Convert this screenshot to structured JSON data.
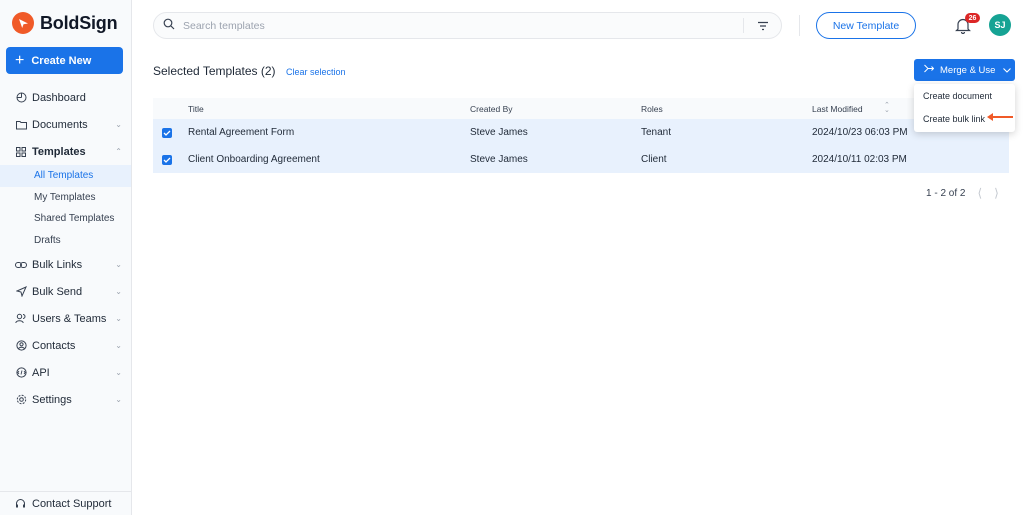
{
  "app": {
    "name": "BoldSign"
  },
  "sidebar": {
    "create_label": "Create New",
    "items": [
      {
        "label": "Dashboard",
        "icon": "dashboard-icon"
      },
      {
        "label": "Documents",
        "icon": "folder-icon"
      },
      {
        "label": "Templates",
        "icon": "grid-icon"
      },
      {
        "label": "Bulk Links",
        "icon": "link-icon"
      },
      {
        "label": "Bulk Send",
        "icon": "send-icon"
      },
      {
        "label": "Users & Teams",
        "icon": "users-icon"
      },
      {
        "label": "Contacts",
        "icon": "contact-icon"
      },
      {
        "label": "API",
        "icon": "api-icon"
      },
      {
        "label": "Settings",
        "icon": "gear-icon"
      }
    ],
    "template_sub": [
      "All Templates",
      "My Templates",
      "Shared Templates",
      "Drafts"
    ],
    "contact_support": "Contact Support"
  },
  "header": {
    "search_placeholder": "Search templates",
    "new_template_label": "New Template",
    "notification_count": "26",
    "avatar_initials": "SJ"
  },
  "toolbar": {
    "selected_title": "Selected Templates (2)",
    "clear_selection": "Clear selection",
    "merge_use_label": "Merge & Use"
  },
  "table": {
    "headers": [
      "Title",
      "Created By",
      "Roles",
      "Last Modified"
    ],
    "rows": [
      {
        "title": "Rental Agreement Form",
        "created_by": "Steve James",
        "roles": "Tenant",
        "modified": "2024/10/23 06:03 PM"
      },
      {
        "title": "Client Onboarding Agreement",
        "created_by": "Steve James",
        "roles": "Client",
        "modified": "2024/10/11 02:03 PM"
      }
    ]
  },
  "pagination": {
    "text": "1 - 2 of 2"
  },
  "dropdown": {
    "items": [
      "Create document",
      "Create bulk link"
    ]
  },
  "colors": {
    "brand": "#f05a28",
    "accent": "#1a73e8",
    "badge": "#dc2626",
    "avatar": "#16a394",
    "arrow": "#f05a28"
  }
}
